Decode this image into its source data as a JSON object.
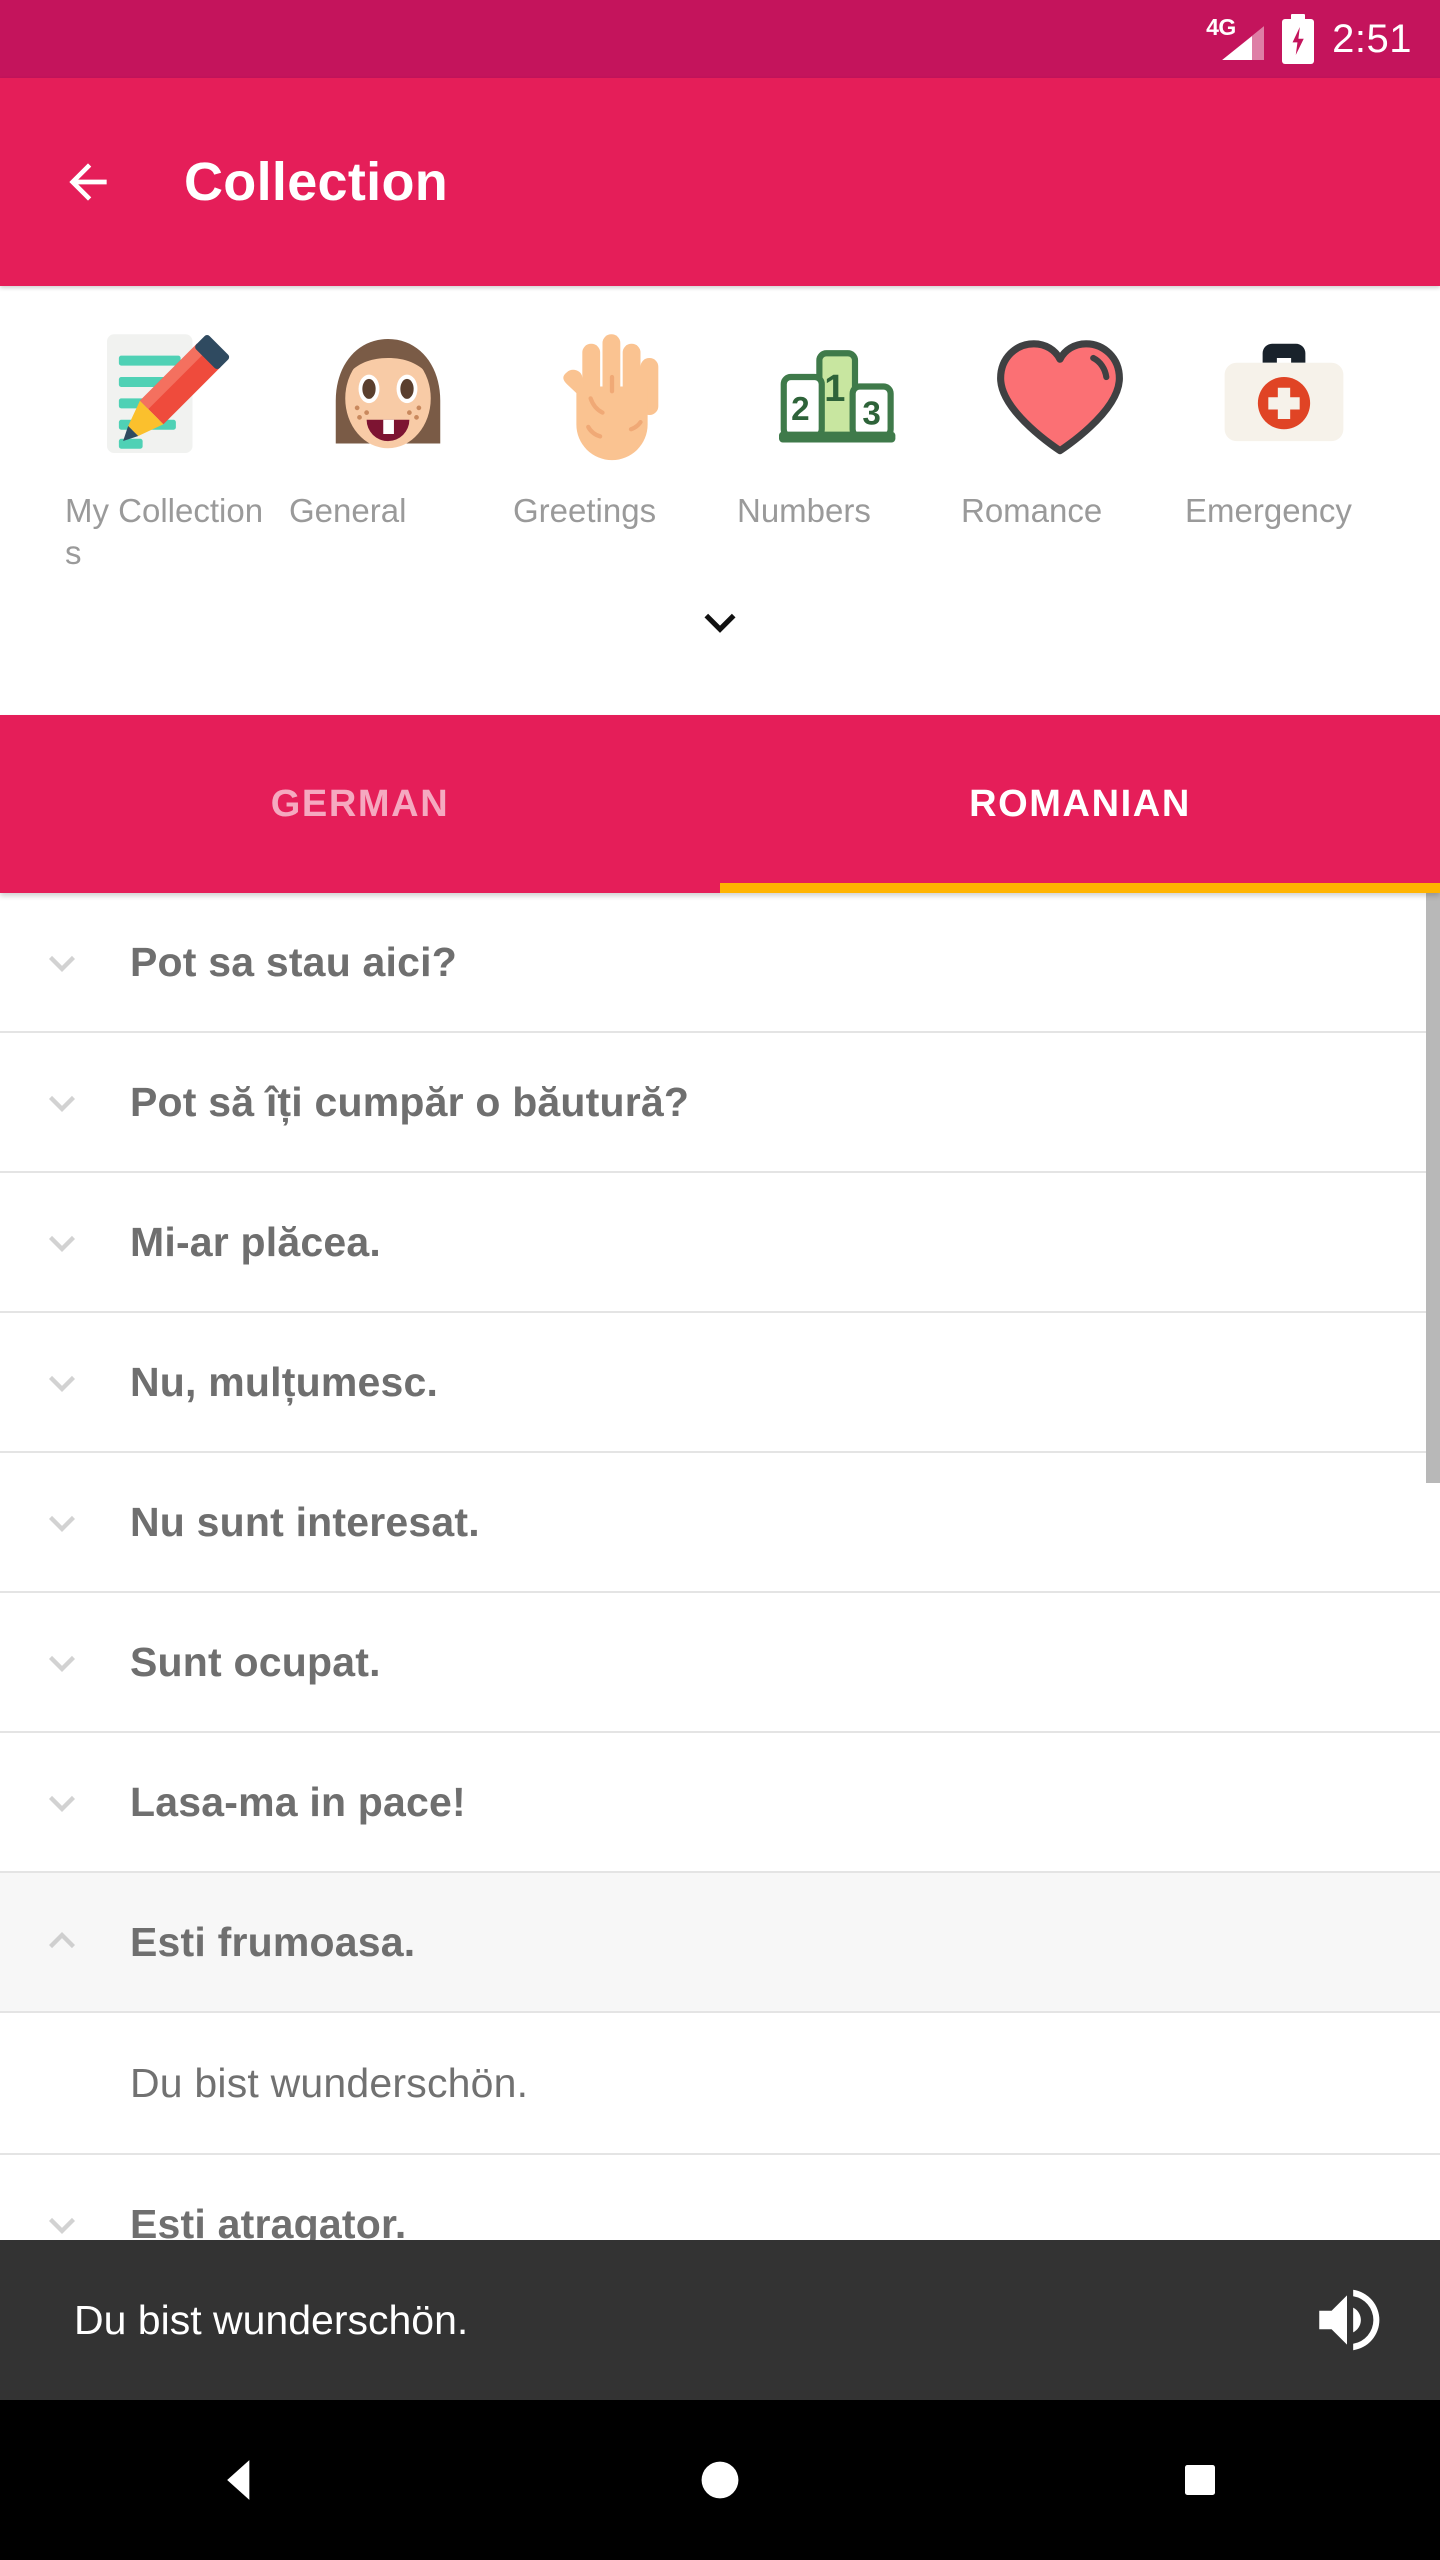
{
  "status_bar": {
    "network_label": "4G",
    "network_icon": "signal-4g-icon",
    "battery_icon": "battery-charging-icon",
    "time": "2:51"
  },
  "app_bar": {
    "back_icon": "back-arrow-icon",
    "title": "Collection"
  },
  "categories": {
    "expand_icon": "chevron-down-icon",
    "items": [
      {
        "label": "My Collections",
        "icon": "notepad-pencil-icon"
      },
      {
        "label": "General",
        "icon": "girl-face-icon"
      },
      {
        "label": "Greetings",
        "icon": "raised-hand-icon"
      },
      {
        "label": "Numbers",
        "icon": "podium-123-icon"
      },
      {
        "label": "Romance",
        "icon": "heart-icon"
      },
      {
        "label": "Emergency",
        "icon": "first-aid-kit-icon"
      }
    ]
  },
  "tabs": {
    "items": [
      {
        "label": "GERMAN",
        "active": false
      },
      {
        "label": "ROMANIAN",
        "active": true
      }
    ],
    "indicator_color": "#FFB300"
  },
  "phrase_list": {
    "collapsed_icon": "chevron-down-icon",
    "expanded_icon": "chevron-up-icon",
    "rows": [
      {
        "text": "Pot sa stau aici?",
        "expanded": false
      },
      {
        "text": "Pot să îți cumpăr o băutură?",
        "expanded": false
      },
      {
        "text": "Mi-ar plăcea.",
        "expanded": false
      },
      {
        "text": "Nu, mulțumesc.",
        "expanded": false
      },
      {
        "text": "Nu sunt interesat.",
        "expanded": false
      },
      {
        "text": "Sunt ocupat.",
        "expanded": false
      },
      {
        "text": "Lasa-ma in pace!",
        "expanded": false
      },
      {
        "text": "Esti frumoasa.",
        "expanded": true,
        "translation": "Du bist wunderschön."
      },
      {
        "text": "Esti atragator.",
        "expanded": false
      }
    ]
  },
  "player_bar": {
    "text": "Du bist wunderschön.",
    "speaker_icon": "speaker-volume-icon"
  },
  "nav_bar": {
    "back_icon": "nav-back-triangle-icon",
    "home_icon": "nav-home-circle-icon",
    "recents_icon": "nav-recents-square-icon"
  },
  "colors": {
    "status_bar": "#C4145C",
    "app_bar": "#E51E59",
    "accent": "#FFB300",
    "player_bar": "#333333"
  }
}
